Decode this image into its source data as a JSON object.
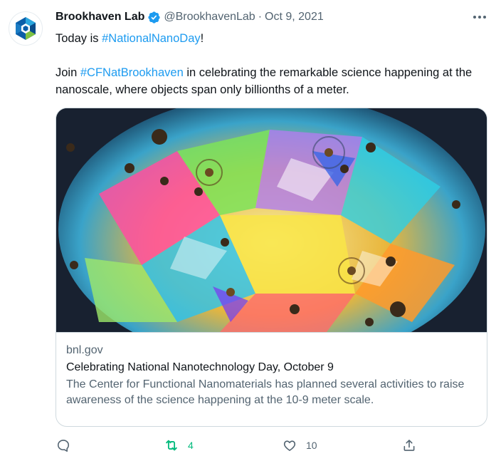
{
  "author": {
    "name": "Brookhaven Lab",
    "handle": "@BrookhavenLab",
    "separator": "·",
    "date": "Oct 9, 2021"
  },
  "tweet": {
    "line1_prefix": "Today is ",
    "line1_hashtag": "#NationalNanoDay",
    "line1_suffix": "!",
    "line2_prefix": "Join ",
    "line2_hashtag": "#CFNatBrookhaven",
    "line2_suffix": " in celebrating the remarkable science happening at the nanoscale, where objects span only billionths of a meter."
  },
  "card": {
    "domain": "bnl.gov",
    "title": "Celebrating National Nanotechnology Day, October 9",
    "description": "The Center for Functional Nanomaterials has planned several activities to raise awareness of the science happening at the 10-9 meter scale."
  },
  "actions": {
    "reply_count": "",
    "retweet_count": "4",
    "like_count": "10"
  },
  "colors": {
    "accent": "#1d9bf0",
    "retweet_active": "#00ba7c",
    "secondary_text": "#536471"
  },
  "icons": [
    "logo-icon",
    "verified-badge-icon",
    "more-options-icon",
    "reply-icon",
    "retweet-icon",
    "like-icon",
    "share-icon"
  ]
}
